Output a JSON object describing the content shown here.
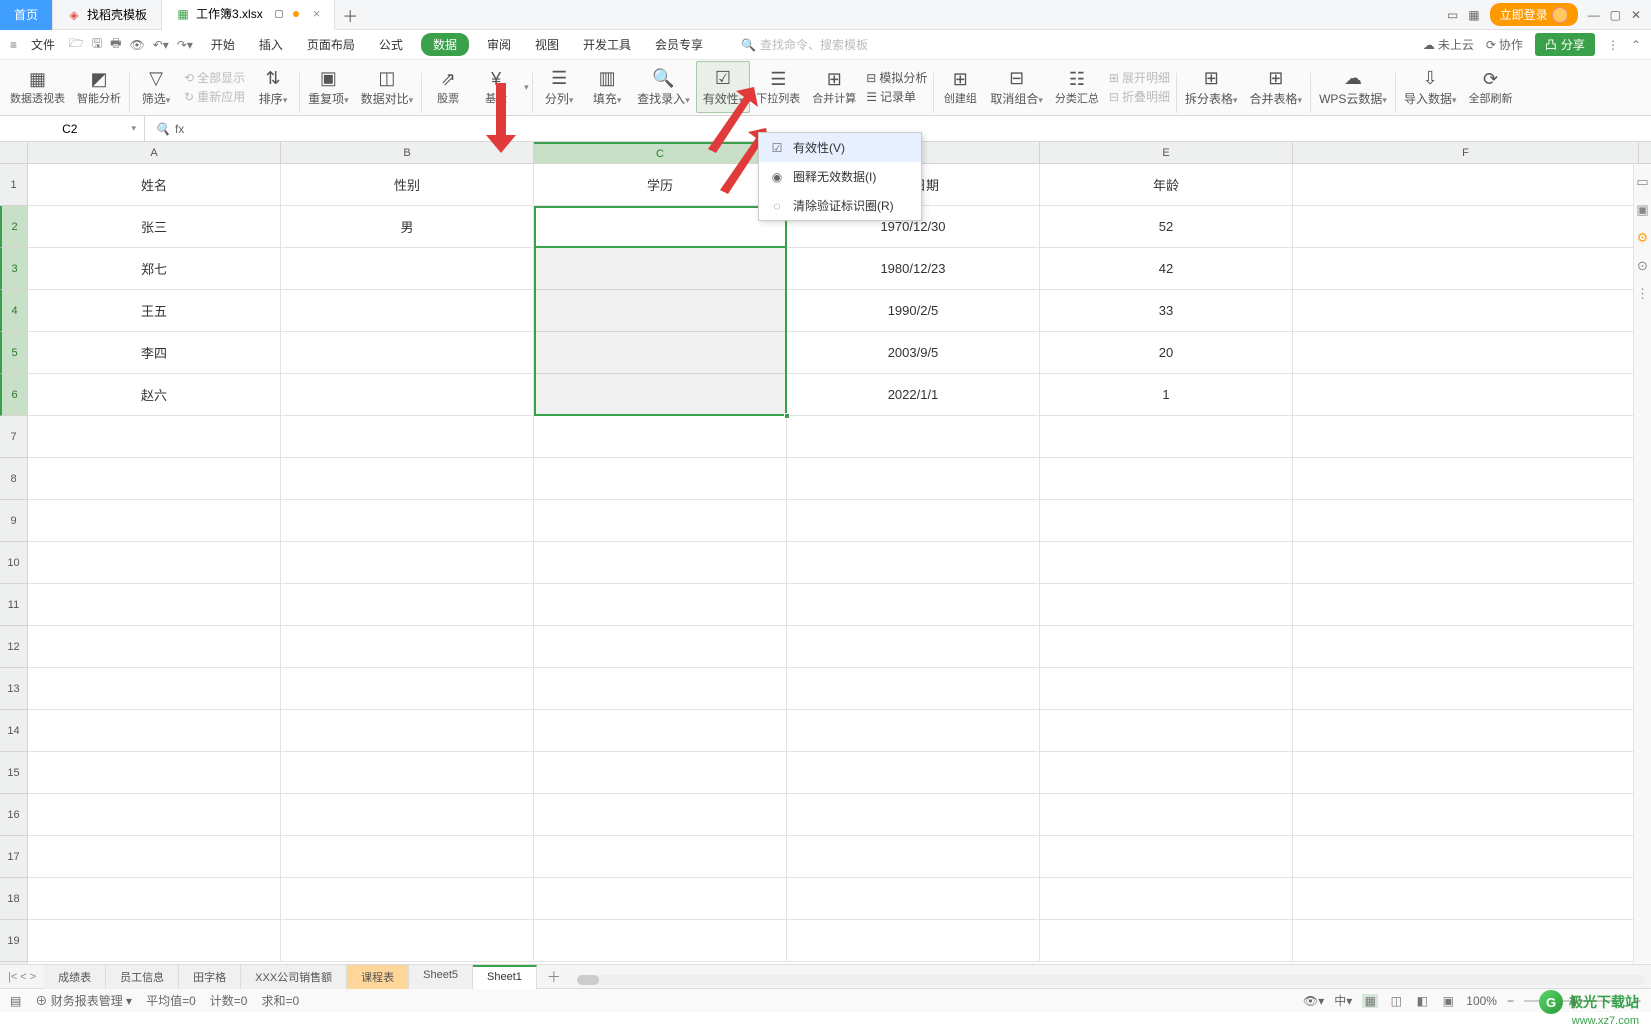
{
  "titlebar": {
    "home": "首页",
    "template_tab": "找稻壳模板",
    "file_tab": "工作簿3.xlsx",
    "login": "立即登录"
  },
  "menubar": {
    "file": "文件",
    "icons": [
      "hamburger",
      "open",
      "save",
      "print",
      "preview",
      "undo",
      "redo"
    ],
    "items": [
      "开始",
      "插入",
      "页面布局",
      "公式",
      "数据",
      "审阅",
      "视图",
      "开发工具",
      "会员专享"
    ],
    "search_placeholder": "查找命令、搜索模板",
    "cloud": "未上云",
    "collab": "协作",
    "share": "分享"
  },
  "ribbon": {
    "pivot": "数据透视表",
    "smart": "智能分析",
    "filter": "筛选",
    "show_all": "全部显示",
    "reapply": "重新应用",
    "sort": "排序",
    "dup": "重复项",
    "compare": "数据对比",
    "stock": "股票",
    "fund": "基金",
    "text_cols": "分列",
    "fill": "填充",
    "findrec": "查找录入",
    "validity": "有效性",
    "dropdown_list": "下拉列表",
    "consolidate": "合并计算",
    "simulate": "模拟分析",
    "record": "记录单",
    "group": "创建组",
    "ungroup": "取消组合",
    "subtotal": "分类汇总",
    "expand": "展开明细",
    "collapse": "折叠明细",
    "split_table": "拆分表格",
    "merge_table": "合并表格",
    "wps_cloud": "WPS云数据",
    "import": "导入数据",
    "refresh_all": "全部刷新"
  },
  "dropdown": {
    "item1": "有效性(V)",
    "item2": "圈释无效数据(I)",
    "item3": "清除验证标识圈(R)"
  },
  "namebox": "C2",
  "columns": [
    "A",
    "B",
    "C",
    "D",
    "E",
    "F"
  ],
  "row_numbers": [
    "1",
    "2",
    "3",
    "4",
    "5",
    "6",
    "7",
    "8",
    "9",
    "10",
    "11",
    "12",
    "13",
    "14",
    "15",
    "16",
    "17",
    "18",
    "19"
  ],
  "headers": {
    "A": "姓名",
    "B": "性别",
    "C": "学历",
    "D": "出生日期",
    "E": "年龄",
    "F": ""
  },
  "rows": [
    {
      "A": "张三",
      "B": "男",
      "C": "",
      "D": "1970/12/30",
      "E": "52",
      "F": ""
    },
    {
      "A": "郑七",
      "B": "",
      "C": "",
      "D": "1980/12/23",
      "E": "42",
      "F": ""
    },
    {
      "A": "王五",
      "B": "",
      "C": "",
      "D": "1990/2/5",
      "E": "33",
      "F": ""
    },
    {
      "A": "李四",
      "B": "",
      "C": "",
      "D": "2003/9/5",
      "E": "20",
      "F": ""
    },
    {
      "A": "赵六",
      "B": "",
      "C": "",
      "D": "2022/1/1",
      "E": "1",
      "F": ""
    }
  ],
  "sheets": {
    "nav": [
      "|<",
      "<",
      ">"
    ],
    "tabs": [
      "成绩表",
      "员工信息",
      "田字格",
      "XXX公司销售额",
      "课程表",
      "Sheet5",
      "Sheet1"
    ],
    "colored_index": 4,
    "active_index": 6
  },
  "statusbar": {
    "task": "财务报表管理",
    "avg": "平均值=0",
    "count": "计数=0",
    "sum": "求和=0",
    "zoom": "100%"
  },
  "watermark": {
    "brand": "极光下载站",
    "url": "www.xz7.com"
  },
  "colors": {
    "primary": "#3aa04a",
    "tab_blue": "#409eff",
    "orange": "#f90"
  }
}
